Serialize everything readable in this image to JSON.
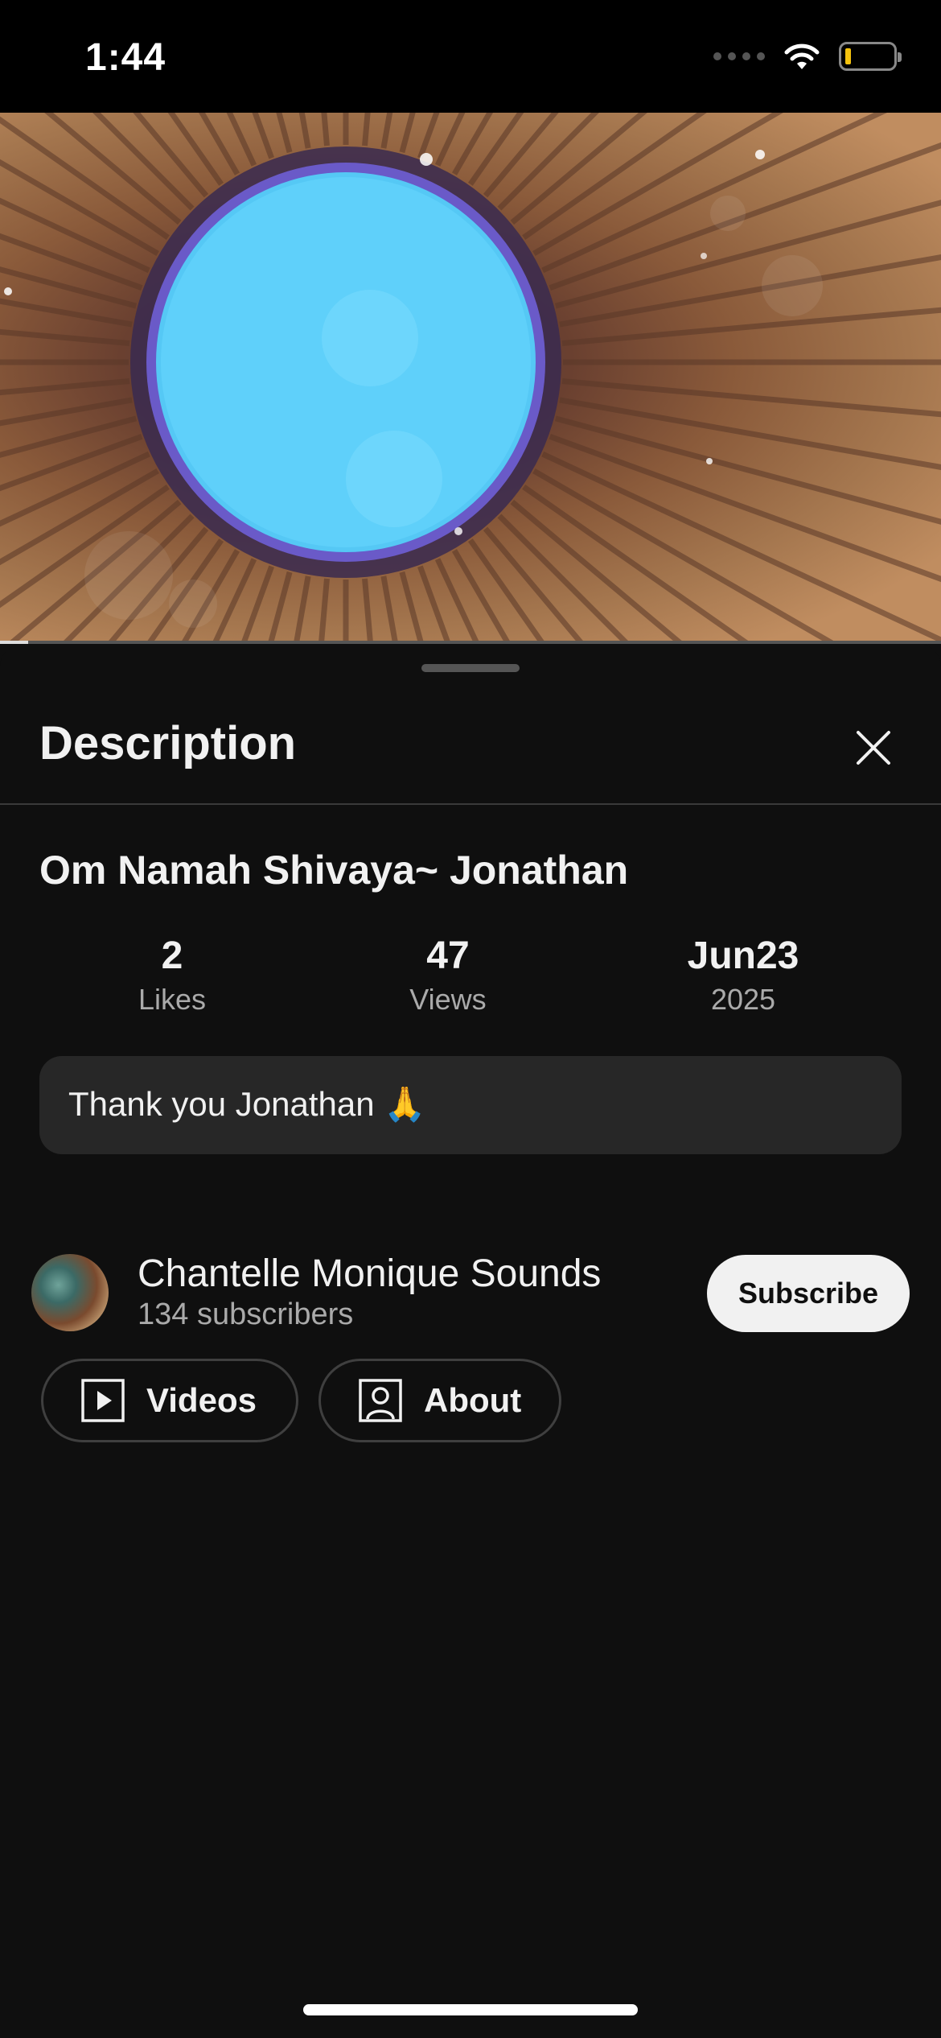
{
  "status_bar": {
    "time": "1:44",
    "battery_color": "#f4c20d"
  },
  "video": {
    "progress_fraction": 0.03
  },
  "sheet": {
    "title": "Description",
    "close_icon": "close-icon"
  },
  "video_info": {
    "title": "Om Namah Shivaya~ Jonathan",
    "stats": [
      {
        "value": "2",
        "label": "Likes"
      },
      {
        "value": "47",
        "label": "Views"
      },
      {
        "value": "Jun23",
        "label": "2025"
      }
    ],
    "description": "Thank you Jonathan 🙏"
  },
  "channel": {
    "name": "Chantelle Monique Sounds",
    "subscribers": "134 subscribers",
    "subscribe_label": "Subscribe",
    "buttons": [
      {
        "label": "Videos",
        "icon": "play-icon"
      },
      {
        "label": "About",
        "icon": "person-icon"
      }
    ]
  },
  "colors": {
    "background": "#0f0f0f",
    "card": "#272727",
    "secondary_text": "#aaaaaa"
  }
}
